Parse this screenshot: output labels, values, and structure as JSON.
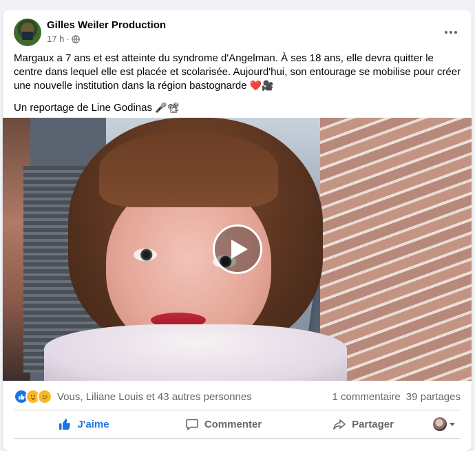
{
  "post": {
    "author": "Gilles Weiler Production",
    "timestamp": "17 h",
    "separator": "·",
    "audience_icon": "globe-icon",
    "body_paragraph_1": "Margaux a 7 ans et est atteinte du syndrome d'Angelman. À ses 18 ans, elle devra quitter le centre dans lequel elle est placée et scolarisée. Aujourd'hui, son entourage se mobilise pour créer une nouvelle institution dans la région bastognarde",
    "body_paragraph_1_emojis": "❤️🎥",
    "body_paragraph_2": "Un reportage de Line Godinas",
    "body_paragraph_2_emojis": "🎤📽"
  },
  "media": {
    "type": "video",
    "play_icon": "play-icon"
  },
  "reactions": {
    "icons": [
      "like-reaction-icon",
      "care-reaction-icon",
      "sad-reaction-icon"
    ],
    "names": "Vous, Liliane Louis et 43 autres personnes",
    "comments": "1 commentaire",
    "shares": "39 partages"
  },
  "actions": {
    "like": "J'aime",
    "comment": "Commenter",
    "share": "Partager"
  },
  "colors": {
    "accent": "#1b74e4",
    "secondary_text": "#65676b",
    "divider": "#ced0d4"
  }
}
